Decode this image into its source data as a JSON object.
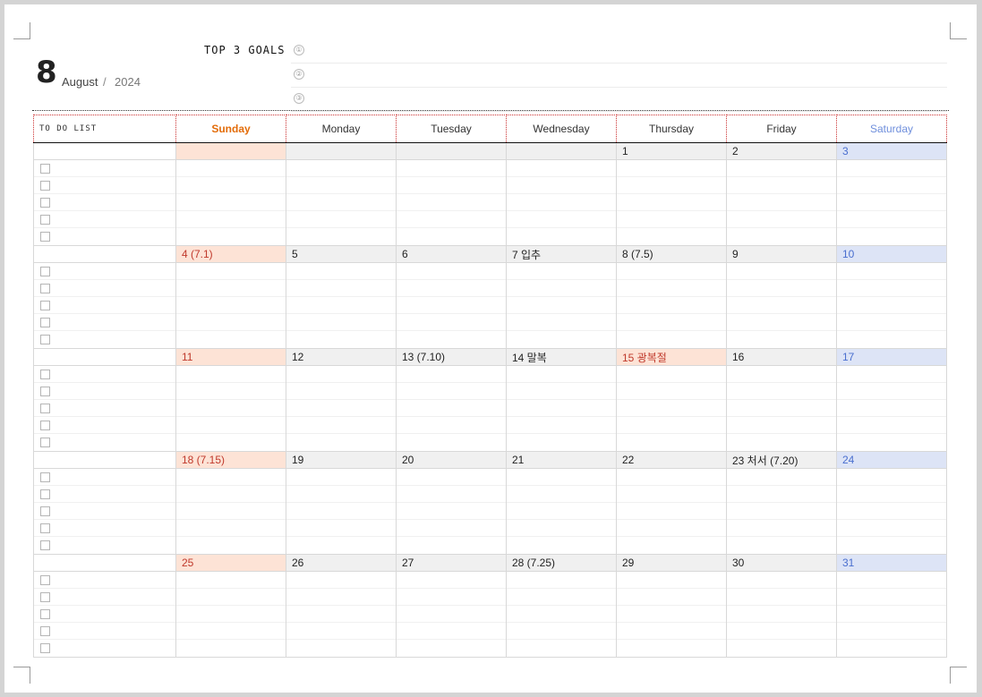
{
  "header": {
    "month_number": "8",
    "month_name": "August",
    "slash": "/",
    "year": "2024",
    "goals_title": "TOP 3 GOALS",
    "goal_markers": [
      "①",
      "②",
      "③"
    ]
  },
  "calendar": {
    "todo_label": "TO DO LIST",
    "weekdays": [
      "Sunday",
      "Monday",
      "Tuesday",
      "Wednesday",
      "Thursday",
      "Friday",
      "Saturday"
    ],
    "weeks": [
      {
        "days": [
          "",
          "",
          "",
          "",
          "1",
          "2",
          "3"
        ],
        "holiday": [
          false,
          false,
          false,
          false,
          false,
          false,
          false
        ]
      },
      {
        "days": [
          "4  (7.1)",
          "5",
          "6",
          "7  입추",
          "8  (7.5)",
          "9",
          "10"
        ],
        "holiday": [
          false,
          false,
          false,
          false,
          false,
          false,
          false
        ]
      },
      {
        "days": [
          "11",
          "12",
          "13  (7.10)",
          "14  말복",
          "15  광복절",
          "16",
          "17"
        ],
        "holiday": [
          false,
          false,
          false,
          false,
          true,
          false,
          false
        ]
      },
      {
        "days": [
          "18  (7.15)",
          "19",
          "20",
          "21",
          "22",
          "23  처서  (7.20)",
          "24"
        ],
        "holiday": [
          false,
          false,
          false,
          false,
          false,
          false,
          false
        ]
      },
      {
        "days": [
          "25",
          "26",
          "27",
          "28  (7.25)",
          "29",
          "30",
          "31"
        ],
        "holiday": [
          false,
          false,
          false,
          false,
          false,
          false,
          false
        ]
      }
    ]
  },
  "colors": {
    "sunday": "#e36c09",
    "saturday": "#6f8fdc",
    "sunday_bg": "#fde3d6",
    "saturday_bg": "#dde4f6"
  }
}
